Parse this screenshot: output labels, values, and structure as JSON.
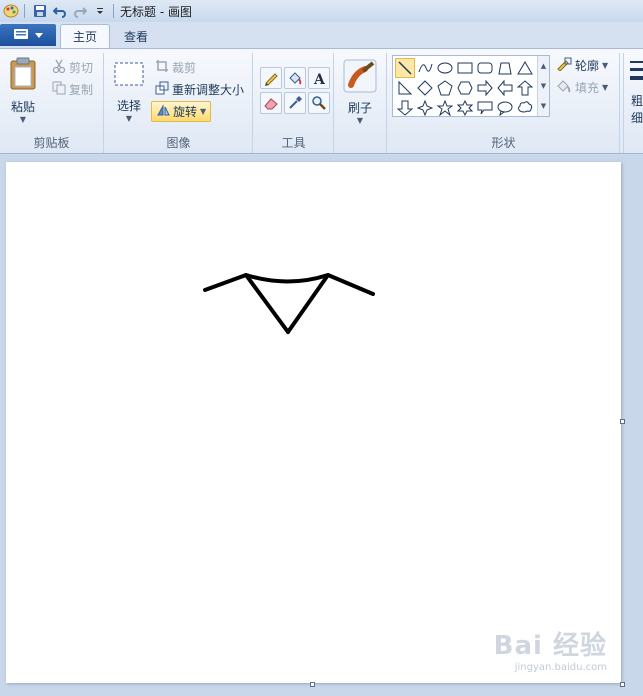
{
  "window": {
    "title": "无标题 - 画图"
  },
  "quick_access": {
    "icons": [
      "paint-app-icon",
      "save-icon",
      "undo-icon",
      "redo-icon",
      "customize-dropdown-icon"
    ]
  },
  "tabs": [
    {
      "label": "主页",
      "active": true
    },
    {
      "label": "查看",
      "active": false
    }
  ],
  "ribbon": {
    "clipboard": {
      "label": "剪贴板",
      "paste": "粘贴",
      "cut": "剪切",
      "copy": "复制"
    },
    "image": {
      "label": "图像",
      "select": "选择",
      "crop": "裁剪",
      "resize": "重新调整大小",
      "rotate": "旋转"
    },
    "tools": {
      "label": "工具",
      "items": [
        "pencil-icon",
        "fill-bucket-icon",
        "text-icon",
        "eraser-icon",
        "color-picker-icon",
        "magnifier-icon"
      ]
    },
    "brushes": {
      "label": "刷子"
    },
    "shapes": {
      "label": "形状",
      "outline": "轮廓",
      "fill": "填充",
      "size_label_partial": "粗",
      "size_label_partial2": "细"
    }
  },
  "colors": {
    "accent": "#1c4f9c",
    "ribbon_bg": "#f0f4fa",
    "selected": "#fde7a6",
    "drawing_stroke": "#000000"
  },
  "watermark": {
    "logo": "Bai 经验",
    "url": "jingyan.baidu.com"
  }
}
